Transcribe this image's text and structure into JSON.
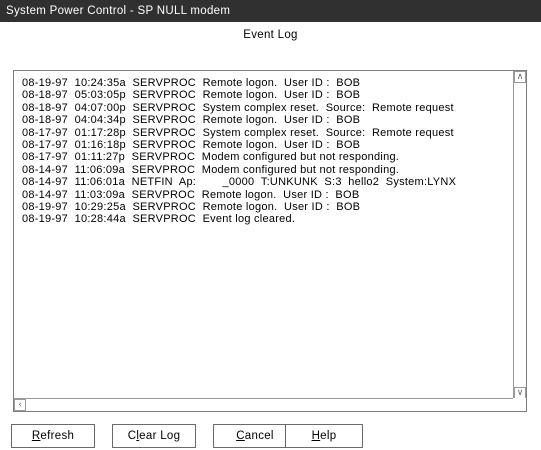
{
  "window": {
    "title": "System Power Control - SP NULL modem"
  },
  "dialog": {
    "heading": "Event Log"
  },
  "log": {
    "lines": [
      "08-19-97  10:24:35a  SERVPROC  Remote logon.  User ID :  BOB",
      "08-18-97  05:03:05p  SERVPROC  Remote logon.  User ID :  BOB",
      "08-18-97  04:07:00p  SERVPROC  System complex reset.  Source:  Remote request",
      "08-18-97  04:04:34p  SERVPROC  Remote logon.  User ID :  BOB",
      "08-17-97  01:17:28p  SERVPROC  System complex reset.  Source:  Remote request",
      "08-17-97  01:16:18p  SERVPROC  Remote logon.  User ID :  BOB",
      "08-17-97  01:11:27p  SERVPROC  Modem configured but not responding.",
      "08-14-97  11:06:09a  SERVPROC  Modem configured but not responding.",
      "08-14-97  11:06:01a  NETFIN  Ap:        _0000  T:UNKUNK  S:3  hello2  System:LYNX",
      "08-14-97  11:03:09a  SERVPROC  Remote logon.  User ID :  BOB",
      "08-19-97  10:29:25a  SERVPROC  Remote logon.  User ID :  BOB",
      "08-19-97  10:28:44a  SERVPROC  Event log cleared."
    ]
  },
  "buttons": {
    "refresh": {
      "mnemonic": "R",
      "rest": "efresh"
    },
    "clear_log": {
      "pre": "C",
      "mnemonic": "l",
      "rest": "ear Log"
    },
    "cancel": {
      "mnemonic": "C",
      "rest": "ancel"
    },
    "help": {
      "mnemonic": "H",
      "rest": "elp"
    }
  },
  "icons": {
    "up": "up-arrow-icon",
    "down": "down-arrow-icon",
    "left": "left-arrow-icon",
    "right": "right-arrow-icon"
  }
}
